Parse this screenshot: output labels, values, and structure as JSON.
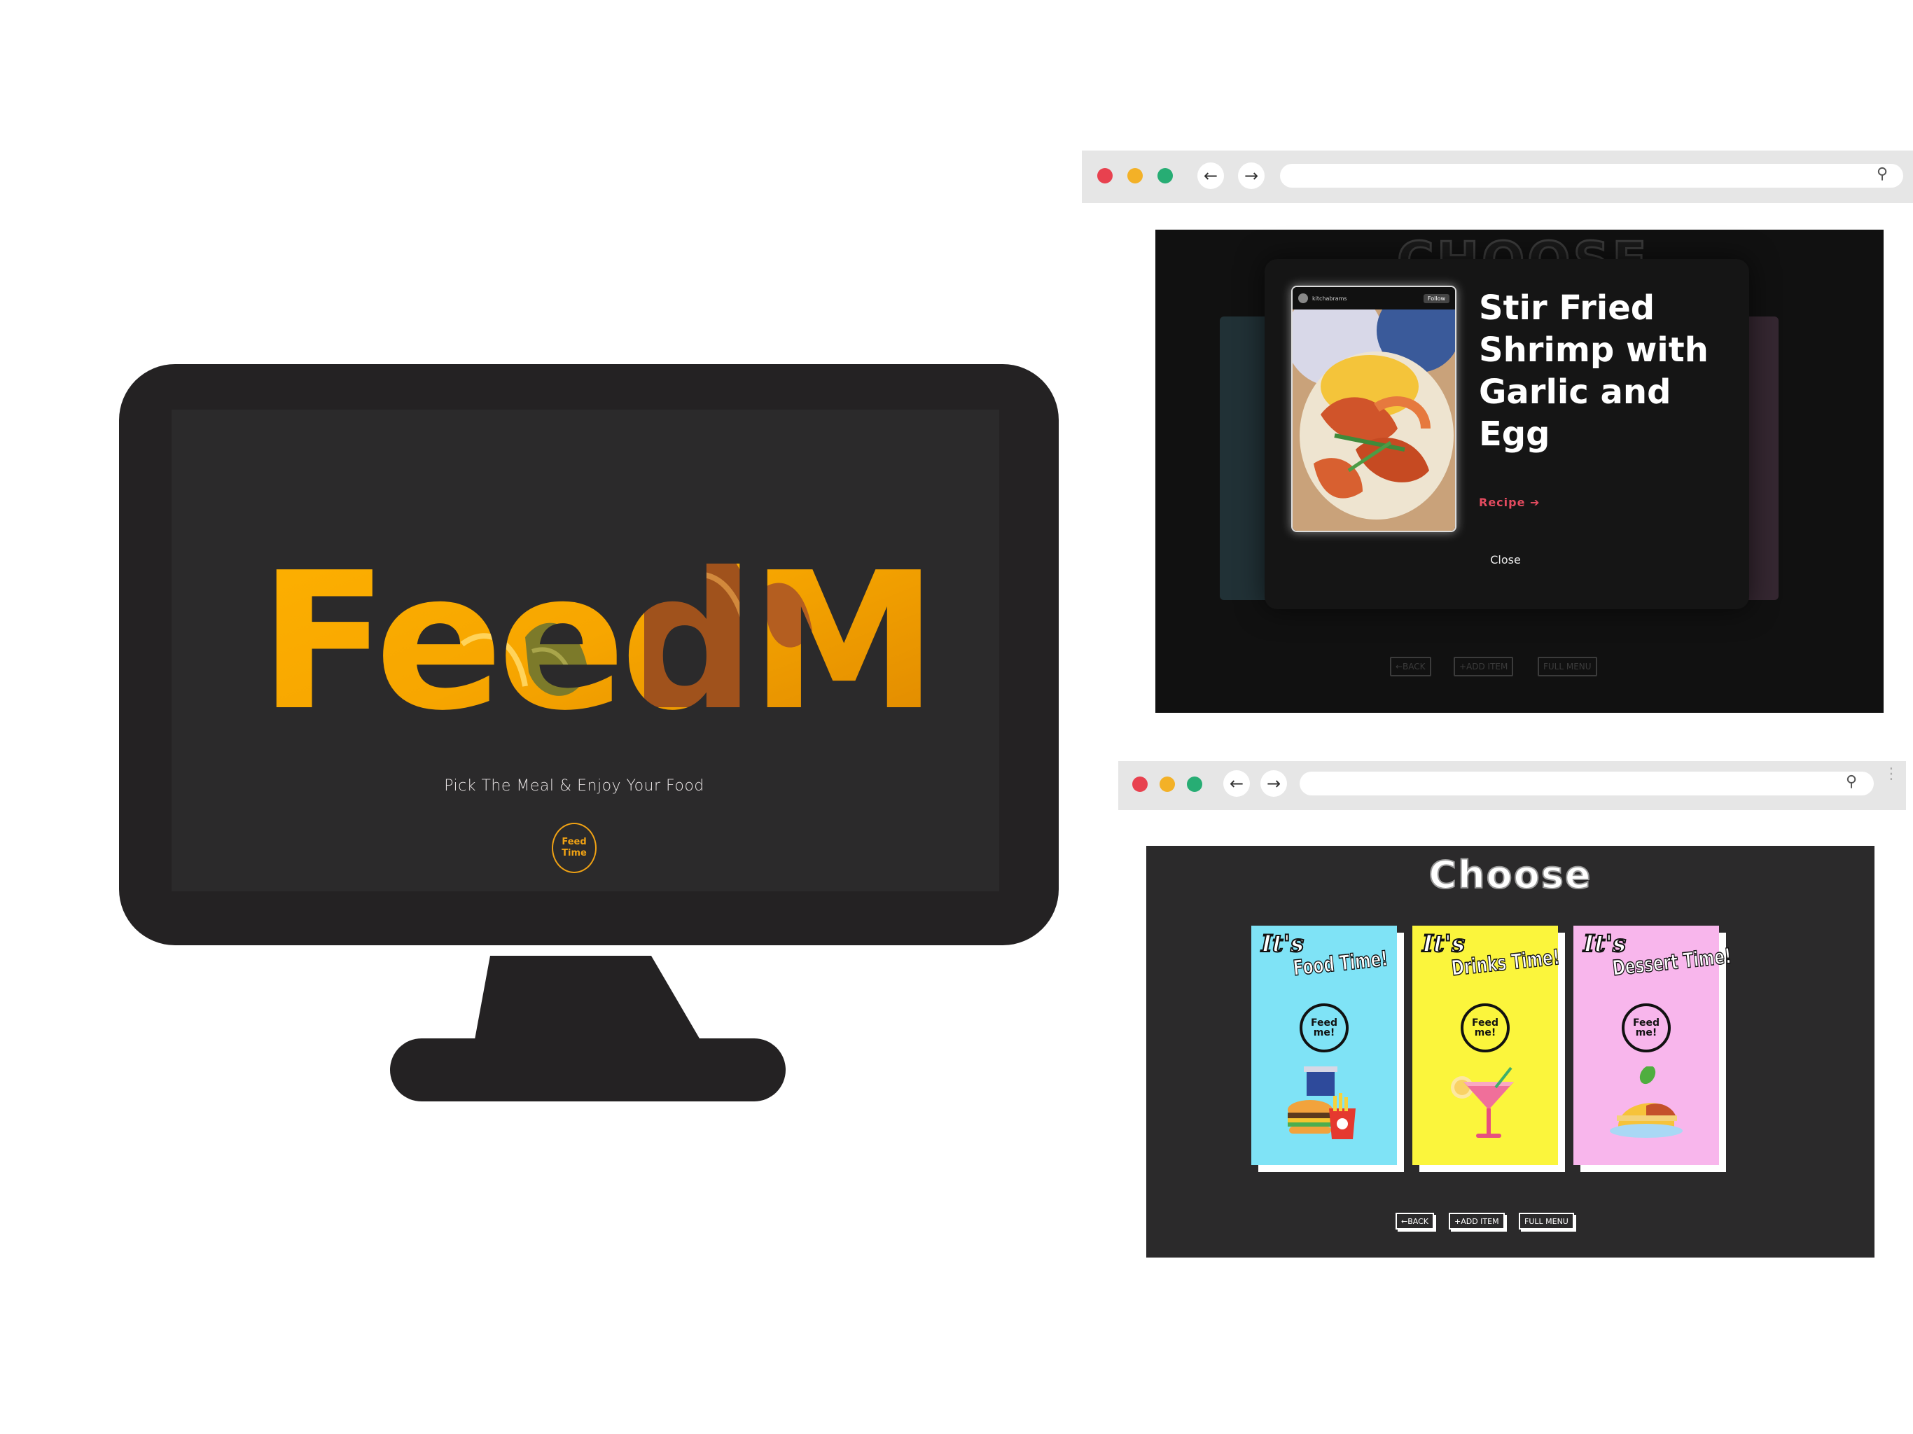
{
  "desktop": {
    "logo_text": "FeedMe",
    "tagline": "Pick The Meal & Enjoy Your Food",
    "cta_line1": "Feed",
    "cta_line2": "Time",
    "colors": {
      "accent": "#f0a214",
      "bg": "#2b2a2b",
      "frame": "#242223"
    }
  },
  "browser_top": {
    "heading": "CHOOSE",
    "modal": {
      "post_user": "kitchabrams",
      "post_follow": "Follow",
      "title": "Stir Fried Shrimp with Garlic and Egg",
      "recipe_link": "Recipe ➔",
      "close_label": "Close"
    },
    "nav_buttons": [
      "←BACK",
      "+ADD ITEM",
      "FULL MENU"
    ]
  },
  "browser_bottom": {
    "heading": "Choose",
    "cards": [
      {
        "its": "It's",
        "title": "Food Time!",
        "button_line1": "Feed",
        "button_line2": "me!",
        "color": "#7fe3f6",
        "icon": "burger-fries-icon"
      },
      {
        "its": "It's",
        "title": "Drinks Time!",
        "button_line1": "Feed",
        "button_line2": "me!",
        "color": "#fbf53c",
        "icon": "cocktail-icon"
      },
      {
        "its": "It's",
        "title": "Dessert Time!",
        "button_line1": "Feed",
        "button_line2": "me!",
        "color": "#f8b6ec",
        "icon": "cake-icon"
      }
    ],
    "nav_buttons": [
      "←BACK",
      "+ADD ITEM",
      "FULL MENU"
    ]
  }
}
